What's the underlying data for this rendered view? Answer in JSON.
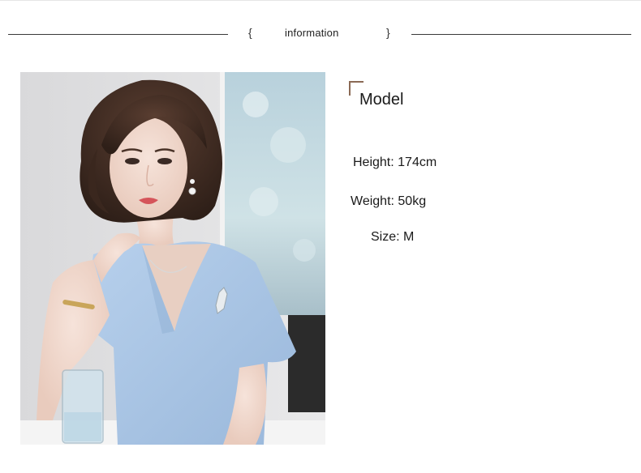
{
  "header": {
    "open_brace": "{",
    "title": "information",
    "close_brace": "}"
  },
  "model": {
    "title": "Model",
    "height_label": "Height: ",
    "height_value": "174cm",
    "weight_label": "Weight: ",
    "weight_value": "50kg",
    "size_label": "Size: ",
    "size_value": "M"
  },
  "colors": {
    "accent_mark": "#8b6a55",
    "rule": "#3a3a3a",
    "dress": "#a9c6e6"
  },
  "photo": {
    "subject": "model-photo"
  }
}
